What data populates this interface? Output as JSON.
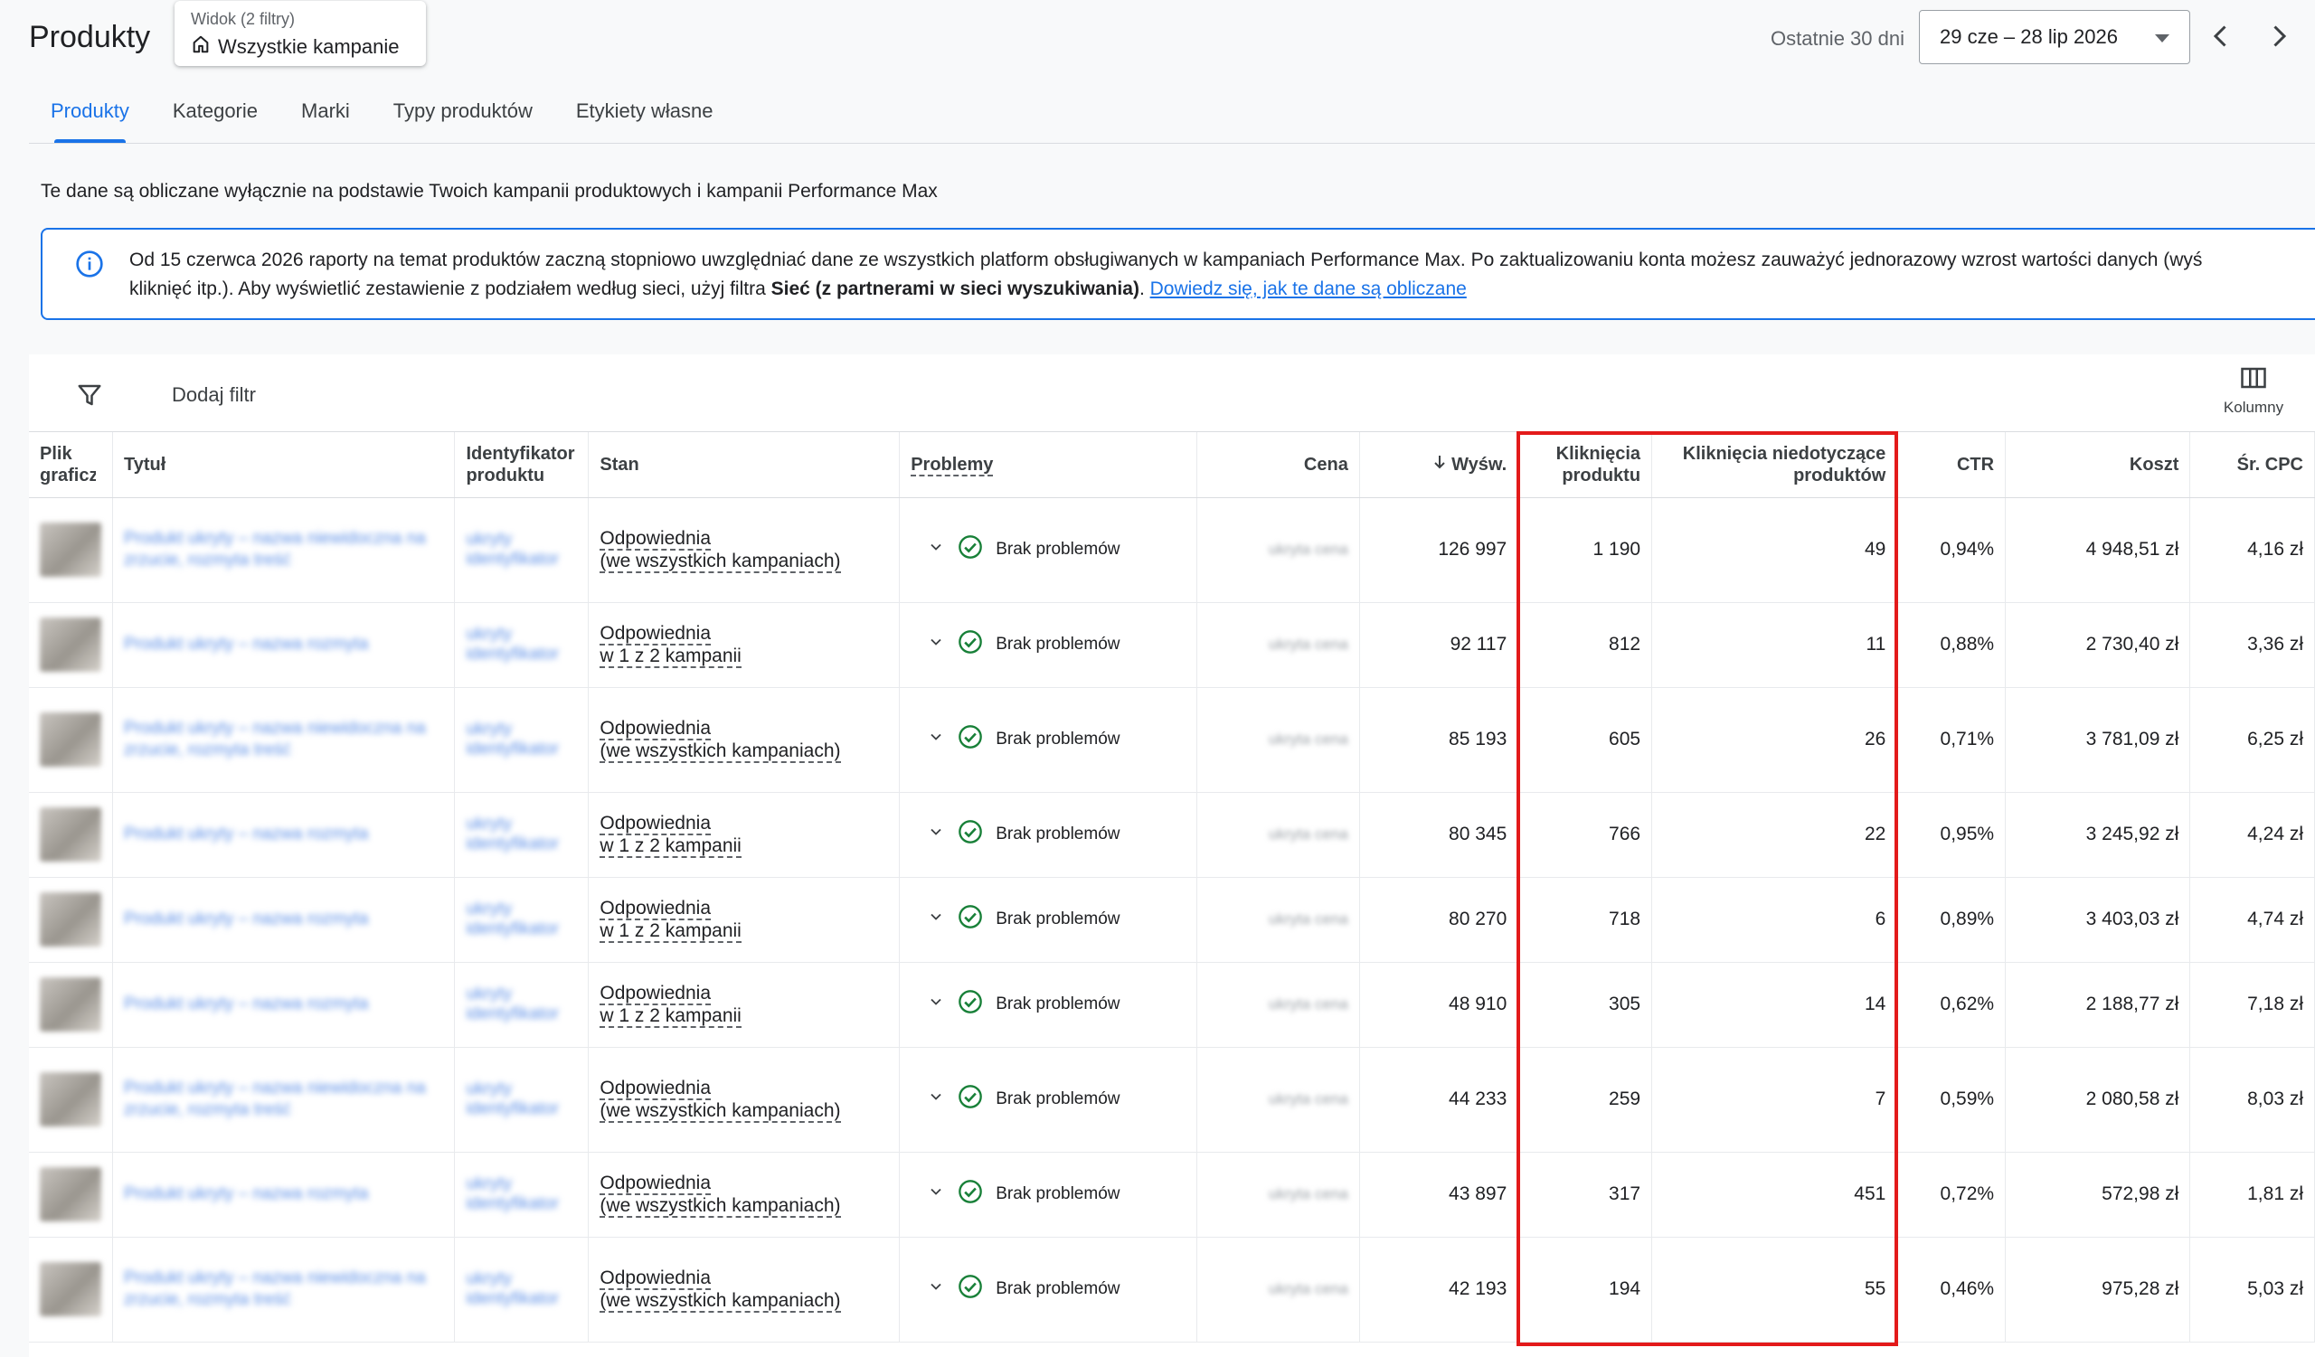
{
  "header": {
    "title": "Produkty",
    "view_chip": {
      "label": "Widok (2 filtry)",
      "value": "Wszystkie kampanie"
    },
    "date_label": "Ostatnie 30 dni",
    "date_range": "29 cze – 28 lip 2026"
  },
  "tabs": [
    {
      "label": "Produkty"
    },
    {
      "label": "Kategorie"
    },
    {
      "label": "Marki"
    },
    {
      "label": "Typy produktów"
    },
    {
      "label": "Etykiety własne"
    }
  ],
  "info_text": "Te dane są obliczane wyłącznie na podstawie Twoich kampanii produktowych i kampanii Performance Max",
  "banner": {
    "line1": "Od 15 czerwca 2026 raporty na temat produktów zaczną stopniowo uwzględniać dane ze wszystkich platform obsługiwanych w kampaniach Performance Max. Po zaktualizowaniu konta możesz zauważyć jednorazowy wzrost wartości danych (wyś",
    "line2_pre": "kliknięć itp.). Aby wyświetlić zestawienie z podziałem według sieci, użyj filtra ",
    "line2_bold": "Sieć (z partnerami w sieci wyszukiwania)",
    "line2_post": ". ",
    "link": "Dowiedz się, jak te dane są obliczane"
  },
  "toolbar": {
    "add_filter": "Dodaj filtr",
    "columns": "Kolumny"
  },
  "columns": {
    "image": "Plik graficzny",
    "title": "Tytuł",
    "id": "Identyfikator produktu",
    "status": "Stan",
    "issues": "Problemy",
    "price": "Cena",
    "impressions": "Wyśw.",
    "product_clicks": "Kliknięcia produktu",
    "non_product_clicks": "Kliknięcia niedotyczące produktów",
    "ctr": "CTR",
    "cost": "Koszt",
    "avg_cpc": "Śr. CPC"
  },
  "sort_icon": "arrow-down-icon",
  "rows": [
    {
      "title": "Produkt ukryty – nazwa niewidoczna na zrzucie, rozmyta treść",
      "id": "ukryty identyfikator",
      "status_1": "Odpowiednia",
      "status_2": "(we wszystkich kampaniach)",
      "issue": "Brak problemów",
      "price": "ukryta cena",
      "impressions": "126 997",
      "product_clicks": "1 190",
      "non_product_clicks": "49",
      "ctr": "0,94%",
      "cost": "4 948,51 zł",
      "avg_cpc": "4,16 zł"
    },
    {
      "title": "Produkt ukryty – nazwa rozmyta",
      "id": "ukryty identyfikator",
      "status_1": "Odpowiednia",
      "status_2": "w 1 z 2 kampanii",
      "issue": "Brak problemów",
      "price": "ukryta cena",
      "impressions": "92 117",
      "product_clicks": "812",
      "non_product_clicks": "11",
      "ctr": "0,88%",
      "cost": "2 730,40 zł",
      "avg_cpc": "3,36 zł"
    },
    {
      "title": "Produkt ukryty – nazwa niewidoczna na zrzucie, rozmyta treść",
      "id": "ukryty identyfikator",
      "status_1": "Odpowiednia",
      "status_2": "(we wszystkich kampaniach)",
      "issue": "Brak problemów",
      "price": "ukryta cena",
      "impressions": "85 193",
      "product_clicks": "605",
      "non_product_clicks": "26",
      "ctr": "0,71%",
      "cost": "3 781,09 zł",
      "avg_cpc": "6,25 zł"
    },
    {
      "title": "Produkt ukryty – nazwa rozmyta",
      "id": "ukryty identyfikator",
      "status_1": "Odpowiednia",
      "status_2": "w 1 z 2 kampanii",
      "issue": "Brak problemów",
      "price": "ukryta cena",
      "impressions": "80 345",
      "product_clicks": "766",
      "non_product_clicks": "22",
      "ctr": "0,95%",
      "cost": "3 245,92 zł",
      "avg_cpc": "4,24 zł"
    },
    {
      "title": "Produkt ukryty – nazwa rozmyta",
      "id": "ukryty identyfikator",
      "status_1": "Odpowiednia",
      "status_2": "w 1 z 2 kampanii",
      "issue": "Brak problemów",
      "price": "ukryta cena",
      "impressions": "80 270",
      "product_clicks": "718",
      "non_product_clicks": "6",
      "ctr": "0,89%",
      "cost": "3 403,03 zł",
      "avg_cpc": "4,74 zł"
    },
    {
      "title": "Produkt ukryty – nazwa rozmyta",
      "id": "ukryty identyfikator",
      "status_1": "Odpowiednia",
      "status_2": "w 1 z 2 kampanii",
      "issue": "Brak problemów",
      "price": "ukryta cena",
      "impressions": "48 910",
      "product_clicks": "305",
      "non_product_clicks": "14",
      "ctr": "0,62%",
      "cost": "2 188,77 zł",
      "avg_cpc": "7,18 zł"
    },
    {
      "title": "Produkt ukryty – nazwa niewidoczna na zrzucie, rozmyta treść",
      "id": "ukryty identyfikator",
      "status_1": "Odpowiednia",
      "status_2": "(we wszystkich kampaniach)",
      "issue": "Brak problemów",
      "price": "ukryta cena",
      "impressions": "44 233",
      "product_clicks": "259",
      "non_product_clicks": "7",
      "ctr": "0,59%",
      "cost": "2 080,58 zł",
      "avg_cpc": "8,03 zł"
    },
    {
      "title": "Produkt ukryty – nazwa rozmyta",
      "id": "ukryty identyfikator",
      "status_1": "Odpowiednia",
      "status_2": "(we wszystkich kampaniach)",
      "issue": "Brak problemów",
      "price": "ukryta cena",
      "impressions": "43 897",
      "product_clicks": "317",
      "non_product_clicks": "451",
      "ctr": "0,72%",
      "cost": "572,98 zł",
      "avg_cpc": "1,81 zł"
    },
    {
      "title": "Produkt ukryty – nazwa niewidoczna na zrzucie, rozmyta treść",
      "id": "ukryty identyfikator",
      "status_1": "Odpowiednia",
      "status_2": "(we wszystkich kampaniach)",
      "issue": "Brak problemów",
      "price": "ukryta cena",
      "impressions": "42 193",
      "product_clicks": "194",
      "non_product_clicks": "55",
      "ctr": "0,46%",
      "cost": "975,28 zł",
      "avg_cpc": "5,03 zł"
    }
  ],
  "colors": {
    "accent": "#1a73e8",
    "success": "#188038",
    "highlight": "#e31a1a"
  }
}
